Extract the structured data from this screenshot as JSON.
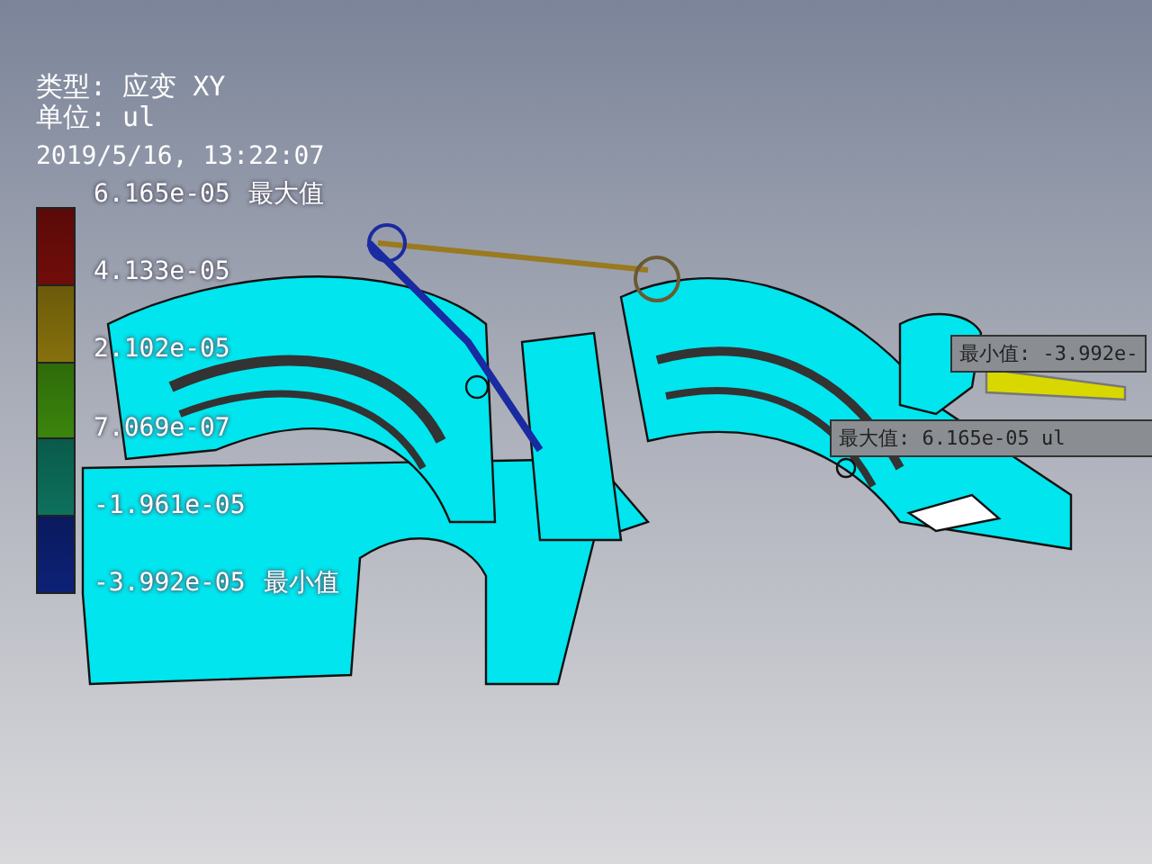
{
  "legend": {
    "type_line": "类型: 应变 XY",
    "unit_line": "单位: ul",
    "timestamp": "2019/5/16, 13:22:07",
    "bands": [
      {
        "color": "#5a0a08"
      },
      {
        "color": "#6b5a0a"
      },
      {
        "color": "#2f6a0a"
      },
      {
        "color": "#0a5a4a"
      },
      {
        "color": "#0a1a5e"
      }
    ],
    "scale": [
      {
        "value": "6.165e-05",
        "note": "最大值"
      },
      {
        "value": "4.133e-05"
      },
      {
        "value": "2.102e-05"
      },
      {
        "value": "7.069e-07"
      },
      {
        "value": "-1.961e-05"
      },
      {
        "value": "-3.992e-05",
        "note": "最小值"
      }
    ]
  },
  "callouts": [
    {
      "kind": "min",
      "text": "最小值: -3.992e-"
    },
    {
      "kind": "max",
      "text": "最大值: 6.165e-05 ul"
    }
  ]
}
